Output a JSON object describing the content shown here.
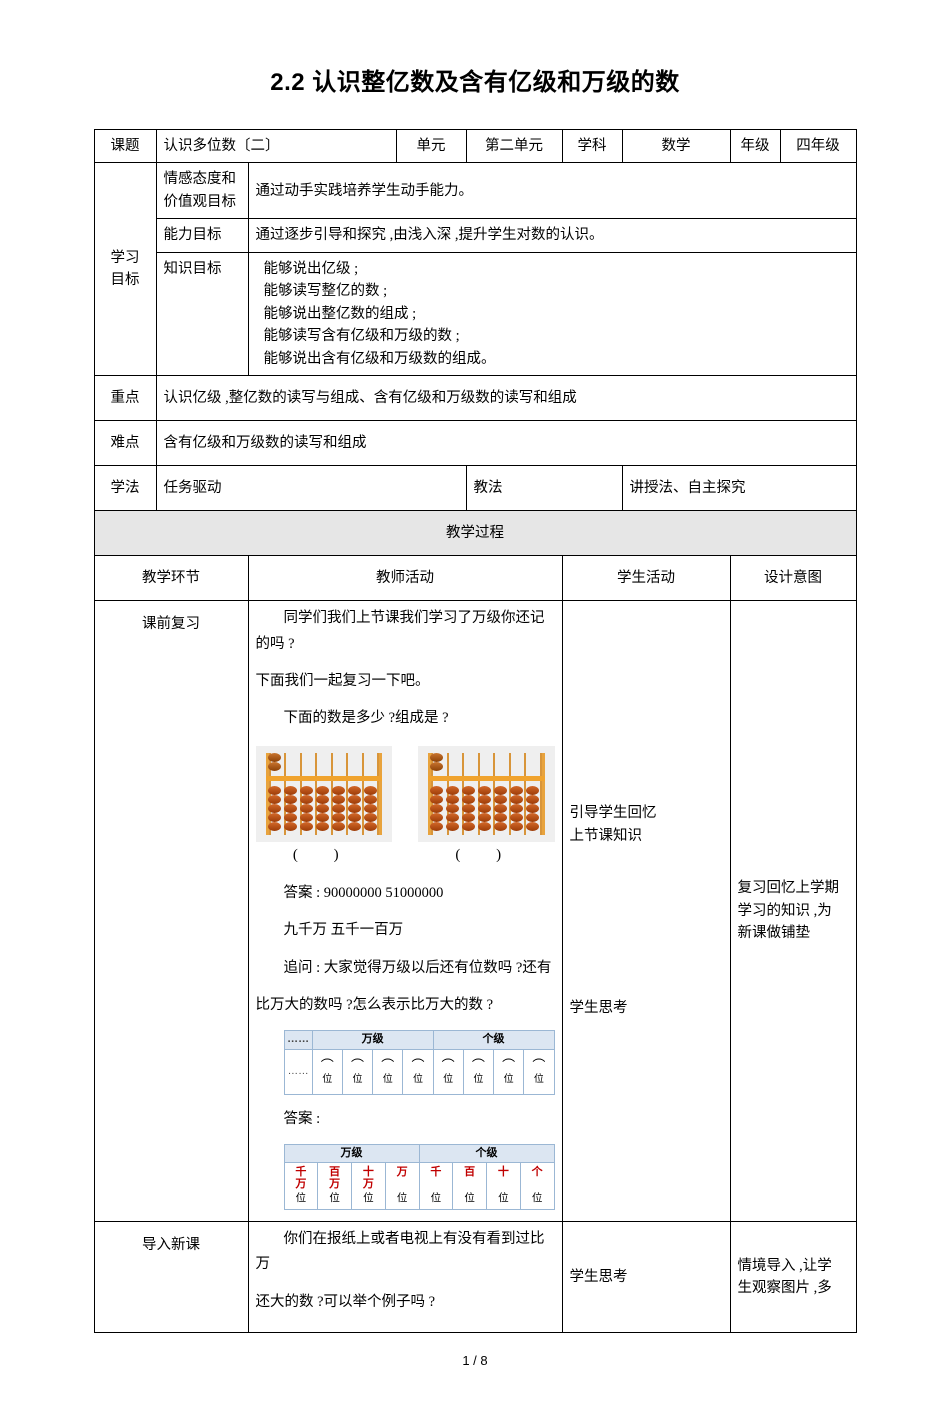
{
  "document": {
    "title": "2.2 认识整亿数及含有亿级和万级的数",
    "page_number": "1 / 8"
  },
  "info_table": {
    "row1": {
      "label_topic": "课题",
      "topic_value": "认识多位数〔二〕",
      "label_unit": "单元",
      "unit_value": "第二单元",
      "label_subject": "学科",
      "subject_value": "数学",
      "label_grade": "年级",
      "grade_value": "四年级"
    },
    "objectives_label": "学习\n目标",
    "objectives_label_line1": "学习",
    "objectives_label_line2": "目标",
    "objectives": [
      {
        "name_line1": "情感态度和",
        "name_line2": "价值观目标",
        "text": "通过动手实践培养学生动手能力。"
      },
      {
        "name_line1": "能力目标",
        "name_line2": "",
        "text": "通过逐步引导和探究 ,由浅入深 ,提升学生对数的认识。"
      },
      {
        "name_line1": "知识目标",
        "name_line2": "",
        "text_lines": [
          "能够说出亿级 ;",
          "能够读写整亿的数 ;",
          "能够说出整亿数的组成 ;",
          "能够读写含有亿级和万级的数 ;",
          "能够说出含有亿级和万级数的组成。"
        ]
      }
    ],
    "key_point_label": "重点",
    "key_point_value": "认识亿级 ,整亿数的读写与组成、含有亿级和万级数的读写和组成",
    "difficulty_label": "难点",
    "difficulty_value": "含有亿级和万级数的读写和组成",
    "study_method_label": "学法",
    "study_method_value": "任务驱动",
    "teach_method_label": "教法",
    "teach_method_value": "讲授法、自主探究"
  },
  "process": {
    "banner": "教学过程",
    "headers": {
      "stage": "教学环节",
      "teacher": "教师活动",
      "student": "学生活动",
      "intent": "设计意图"
    },
    "rows": [
      {
        "stage": "课前复习",
        "teacher_p1": "同学们我们上节课我们学习了万级你还记的吗 ?",
        "teacher_p2": "下面我们一起复习一下吧。",
        "teacher_p3": "下面的数是多少 ?组成是 ?",
        "paren_left": "(            )",
        "paren_right": "(            )",
        "answer_label": "答案 : 90000000        51000000",
        "answer_words": "九千万        五千一百万",
        "followup_p1": "追问 : 大家觉得万级以后还有位数吗 ?还有",
        "followup_p2": "比万大的数吗 ?怎么表示比万大的数 ?",
        "answer2_label": "答案 :",
        "student_lines": [
          "引导学生回忆",
          "上节课知识",
          "",
          "",
          "",
          "学生思考"
        ],
        "intent_lines": [
          "复习回忆上学期",
          "学习的知识 ,为",
          "新课做铺垫"
        ]
      },
      {
        "stage": "导入新课",
        "teacher_p1": "你们在报纸上或者电视上有没有看到过比万",
        "teacher_p2": "还大的数 ?可以举个例子吗 ?",
        "student_lines": [
          "学生思考"
        ],
        "intent_lines": [
          "情境导入 ,让学",
          "生观察图片 ,多"
        ]
      }
    ]
  },
  "place_value_table_blank": {
    "dots": "……",
    "group_headers": [
      "万级",
      "个级"
    ],
    "cells": [
      {
        "arc": "⌒",
        "unit": "位"
      },
      {
        "arc": "⌒",
        "unit": "位"
      },
      {
        "arc": "⌒",
        "unit": "位"
      },
      {
        "arc": "⌒",
        "unit": "位"
      },
      {
        "arc": "⌒",
        "unit": "位"
      },
      {
        "arc": "⌒",
        "unit": "位"
      },
      {
        "arc": "⌒",
        "unit": "位"
      },
      {
        "arc": "⌒",
        "unit": "位"
      }
    ]
  },
  "place_value_table_answer": {
    "group_headers": [
      "万级",
      "个级"
    ],
    "cells": [
      {
        "name_line1": "千",
        "name_line2": "万",
        "unit": "位"
      },
      {
        "name_line1": "百",
        "name_line2": "万",
        "unit": "位"
      },
      {
        "name_line1": "十",
        "name_line2": "万",
        "unit": "位"
      },
      {
        "name_line1": "万",
        "name_line2": "",
        "unit": "位"
      },
      {
        "name_line1": "千",
        "name_line2": "",
        "unit": "位"
      },
      {
        "name_line1": "百",
        "name_line2": "",
        "unit": "位"
      },
      {
        "name_line1": "十",
        "name_line2": "",
        "unit": "位"
      },
      {
        "name_line1": "个",
        "name_line2": "",
        "unit": "位"
      }
    ]
  },
  "colors": {
    "header_gray": "#e6e6e6",
    "pv_header_blue": "#dce6f2",
    "pv_border_blue": "#9bb7d4",
    "pv_red_text": "#c00000",
    "abacus_frame": "#e8a33d",
    "abacus_bead": "#b0470f"
  }
}
